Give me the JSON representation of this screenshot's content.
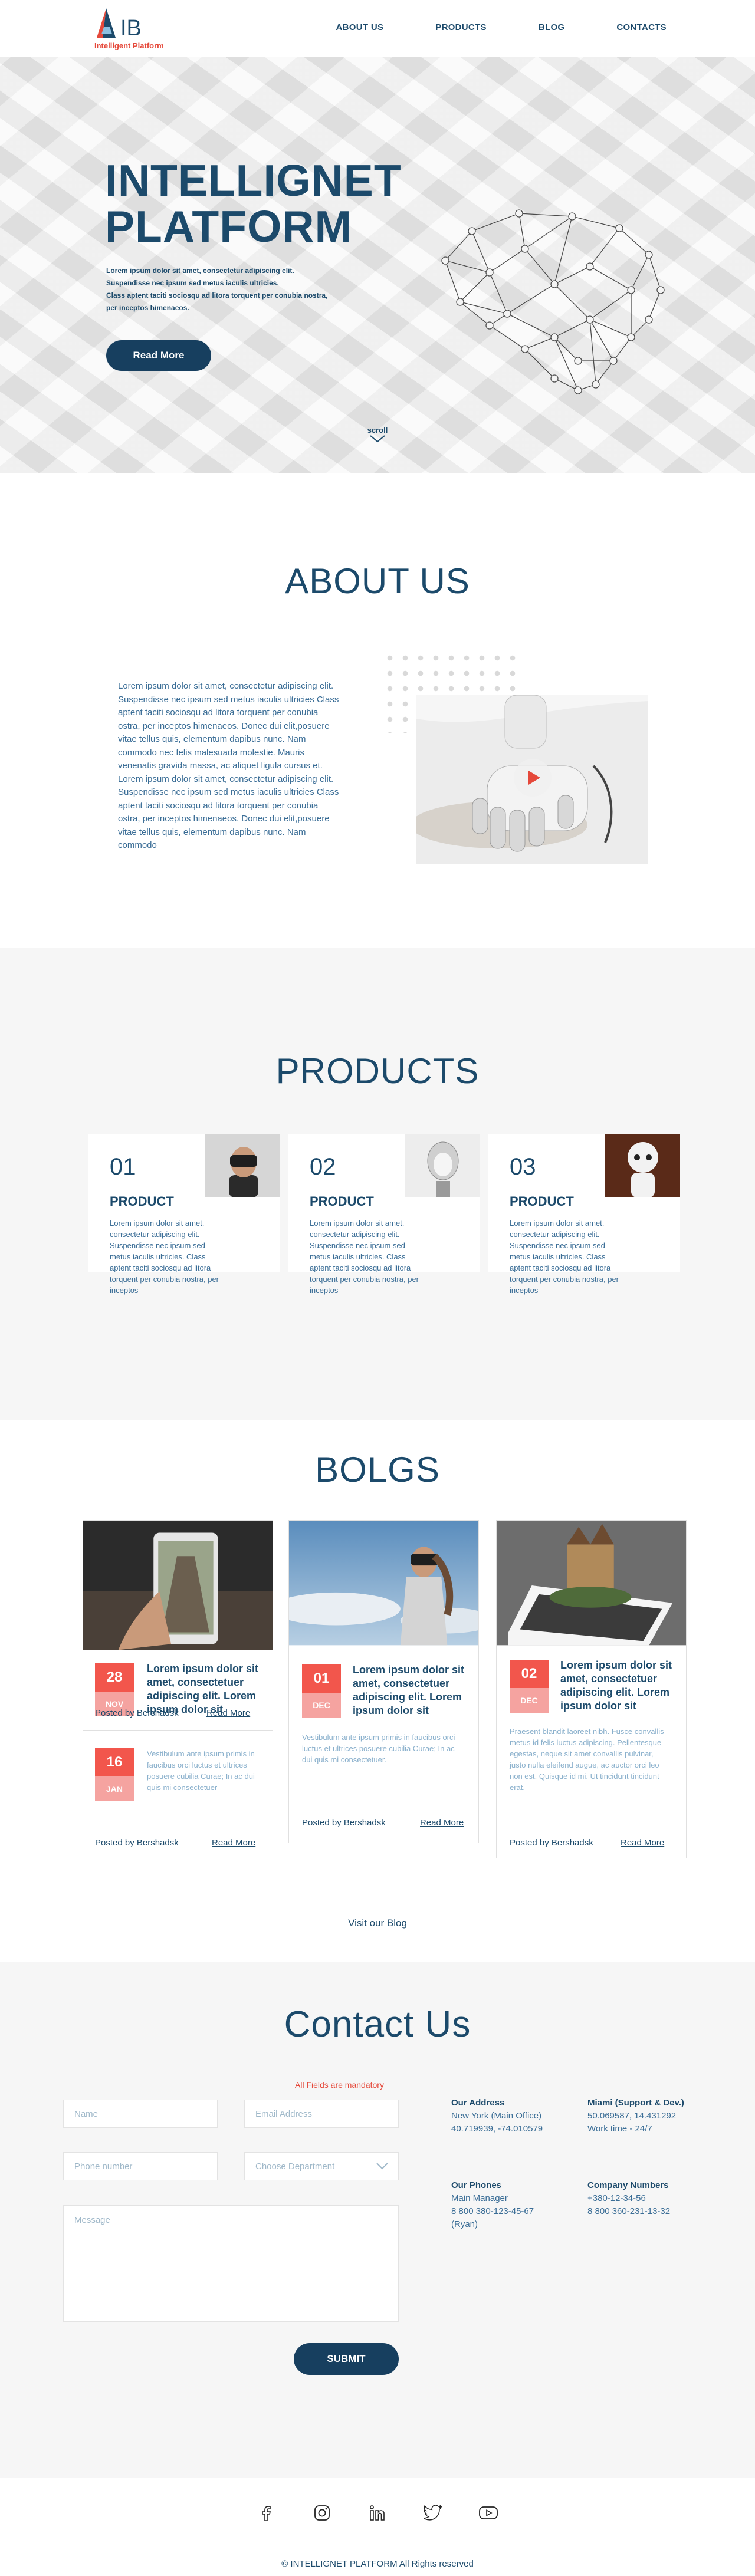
{
  "header": {
    "logo_letters": "IB",
    "logo_sub": "Intelligent Platform",
    "nav": [
      "ABOUT US",
      "PRODUCTS",
      "BLOG",
      "CONTACTS"
    ]
  },
  "hero": {
    "title_line1": "INTELLIGNET",
    "title_line2": "PLATFORM",
    "desc_line1": "Lorem ipsum dolor sit amet, consectetur adipiscing elit.",
    "desc_line2": "Suspendisse nec ipsum sed metus iaculis ultricies.",
    "desc_line3": "Class aptent taciti sociosqu ad litora torquent per conubia nostra,",
    "desc_line4": "per inceptos himenaeos.",
    "button": "Read More",
    "scroll": "scroll"
  },
  "about": {
    "title": "ABOUT US",
    "text": "Lorem ipsum dolor sit amet, consectetur adipiscing elit. Suspendisse nec ipsum sed metus iaculis ultricies Class aptent taciti sociosqu ad litora torquent per conubia  ostra, per inceptos himenaeos. Donec dui elit,posuere vitae tellus quis, elementum dapibus nunc. Nam commodo nec felis malesuada molestie. Mauris venenatis gravida massa, ac aliquet ligula cursus et. Lorem ipsum dolor sit amet, consectetur adipiscing elit. Suspendisse nec ipsum sed metus iaculis ultricies Class aptent taciti sociosqu ad litora torquent per conubia  ostra, per inceptos himenaeos. Donec dui elit,posuere vitae tellus quis, elementum dapibus nunc. Nam commodo"
  },
  "products": {
    "title": "PRODUCTS",
    "items": [
      {
        "num": "01",
        "name": "PRODUCT",
        "text": "Lorem ipsum dolor sit amet, consectetur adipiscing elit. Suspendisse nec ipsum sed metus iaculis ultricies. Class aptent taciti sociosqu ad litora torquent per conubia nostra, per inceptos"
      },
      {
        "num": "02",
        "name": "PRODUCT",
        "text": "Lorem ipsum dolor sit amet, consectetur adipiscing elit. Suspendisse nec ipsum sed metus iaculis ultricies. Class aptent taciti sociosqu ad litora torquent per conubia nostra, per inceptos"
      },
      {
        "num": "03",
        "name": "PRODUCT",
        "text": "Lorem ipsum dolor sit amet, consectetur adipiscing elit. Suspendisse nec ipsum sed metus iaculis ultricies. Class aptent taciti sociosqu ad litora torquent per conubia nostra, per inceptos"
      }
    ]
  },
  "blogs": {
    "title": "BOLGS",
    "card1": {
      "day": "28",
      "month": "NOV",
      "title": "Lorem ipsum dolor sit amet, consectetuer adipiscing elit. Lorem ipsum dolor sit",
      "by": "Posted by Bershadsk",
      "more": "Read More"
    },
    "card2": {
      "day": "16",
      "month": "JAN",
      "excerpt": "Vestibulum ante ipsum primis in faucibus orci luctus et ultrices posuere cubilia Curae; In ac dui quis mi consectetuer",
      "by": "Posted by Bershadsk",
      "more": "Read More"
    },
    "card3": {
      "day": "01",
      "month": "DEC",
      "title": "Lorem ipsum dolor sit amet, consectetuer adipiscing elit. Lorem ipsum dolor sit",
      "excerpt": "Vestibulum ante ipsum primis in faucibus orci luctus et ultrices posuere cubilia Curae; In ac dui quis mi consectetuer.",
      "by": "Posted by Bershadsk",
      "more": "Read More"
    },
    "card4": {
      "day": "02",
      "month": "DEC",
      "title": "Lorem ipsum dolor sit amet, consectetuer adipiscing elit. Lorem ipsum dolor sit",
      "excerpt": "Praesent blandit laoreet nibh. Fusce convallis metus id felis luctus adipiscing. Pellentesque egestas, neque sit amet convallis pulvinar, justo nulla eleifend augue, ac auctor orci leo non est. Quisque id mi. Ut tincidunt tincidunt erat.",
      "by": "Posted by Bershadsk",
      "more": "Read More"
    },
    "visit": "Visit our Blog"
  },
  "contact": {
    "title": "Contact Us",
    "mandatory": "All Fields are mandatory",
    "name_ph": "Name",
    "email_ph": "Email Address",
    "phone_ph": "Phone number",
    "dept_ph": "Choose Department",
    "message_ph": "Message",
    "submit": "SUBMIT",
    "address": {
      "heading": "Our Address",
      "line1": "New York (Main Office)",
      "line2": "40.719939, -74.010579"
    },
    "miami": {
      "heading": "Miami (Support & Dev.)",
      "line1": "50.069587, 14.431292",
      "line2": "Work time - 24/7"
    },
    "phones": {
      "heading": "Our Phones",
      "line1": "Main Manager",
      "line2": "8 800 380-123-45-67",
      "line3": "(Ryan)"
    },
    "company": {
      "heading": "Company Numbers",
      "line1": "+380-12-34-56",
      "line2": "8 800 360-231-13-32"
    }
  },
  "footer": {
    "socials": [
      "facebook-icon",
      "instagram-icon",
      "linkedin-icon",
      "twitter-icon",
      "youtube-icon"
    ],
    "copyright": "© INTELLIGNET PLATFORM All Rights reserved"
  }
}
